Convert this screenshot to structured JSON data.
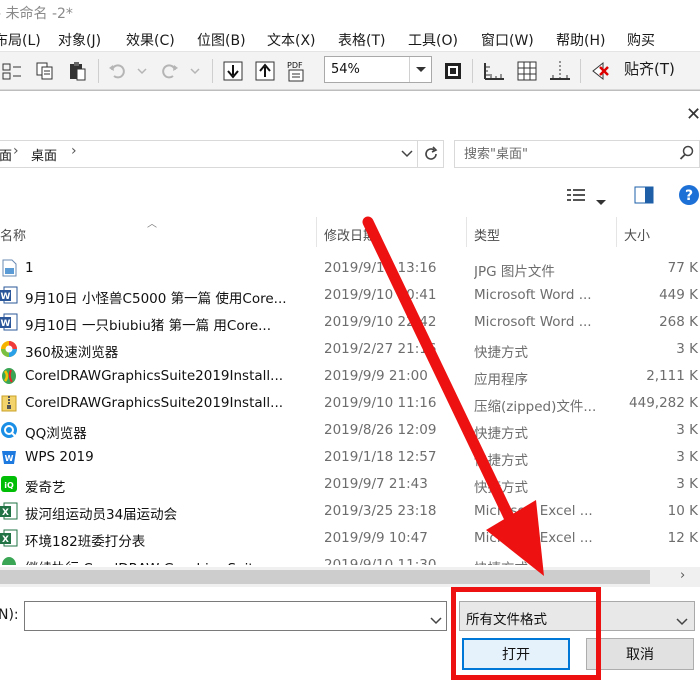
{
  "app": {
    "title": "- 未命名 -2*",
    "menu": [
      "布局(L)",
      "对象(J)",
      "效果(C)",
      "位图(B)",
      "文本(X)",
      "表格(T)",
      "工具(O)",
      "窗口(W)",
      "帮助(H)",
      "购买"
    ],
    "toolbar": {
      "zoom_value": "54%",
      "snap_label": "贴齐(T)"
    }
  },
  "dialog": {
    "close_glyph": "✕",
    "breadcrumb": [
      "面",
      "桌面"
    ],
    "search_placeholder": "搜索\"桌面\"",
    "columns": {
      "name": "名称",
      "date": "修改日期",
      "type": "类型",
      "size": "大小"
    },
    "files": [
      {
        "name": "1",
        "date": "2019/9/11 13:16",
        "type": "JPG 图片文件",
        "size": "77 K",
        "icon": "image-file-icon"
      },
      {
        "name": "9月10日 小怪兽C5000 第一篇 使用Core...",
        "date": "2019/9/10 20:41",
        "type": "Microsoft Word ...",
        "size": "449 K",
        "icon": "word-doc-icon"
      },
      {
        "name": "9月10日 一只biubiu猪 第一篇 用Core...",
        "date": "2019/9/10 22:42",
        "type": "Microsoft Word ...",
        "size": "268 K",
        "icon": "word-doc-icon"
      },
      {
        "name": "360极速浏览器",
        "date": "2019/2/27 21:16",
        "type": "快捷方式",
        "size": "3 K",
        "icon": "browser-360-icon"
      },
      {
        "name": "CorelDRAWGraphicsSuite2019Install...",
        "date": "2019/9/9 21:00",
        "type": "应用程序",
        "size": "2,111 K",
        "icon": "installer-icon"
      },
      {
        "name": "CorelDRAWGraphicsSuite2019Install...",
        "date": "2019/9/10 11:16",
        "type": "压缩(zipped)文件...",
        "size": "449,282 K",
        "icon": "zip-folder-icon"
      },
      {
        "name": "QQ浏览器",
        "date": "2019/8/26 12:09",
        "type": "快捷方式",
        "size": "3 K",
        "icon": "qq-browser-icon"
      },
      {
        "name": "WPS 2019",
        "date": "2019/1/18 12:57",
        "type": "快捷方式",
        "size": "3 K",
        "icon": "wps-icon"
      },
      {
        "name": "爱奇艺",
        "date": "2019/9/7 21:43",
        "type": "快捷方式",
        "size": "3 K",
        "icon": "iqiyi-icon"
      },
      {
        "name": "拔河组运动员34届运动会",
        "date": "2019/3/25 23:18",
        "type": "Microsoft Excel ...",
        "size": "10 K",
        "icon": "excel-icon"
      },
      {
        "name": "环境182班委打分表",
        "date": "2019/9/9 10:47",
        "type": "Microsoft Excel ...",
        "size": "12 K",
        "icon": "excel-icon"
      },
      {
        "name": "继续执行 CorelDRAW Graphics Suit...",
        "date": "2019/9/10 11:30",
        "type": "快捷方式",
        "size": "",
        "icon": "shortcut-icon"
      }
    ],
    "filename_label": "N):",
    "filename_value": "",
    "filetype_value": "所有文件格式",
    "open_label": "打开",
    "cancel_label": "取消"
  },
  "colors": {
    "annotation_red": "#ee1111",
    "focus_blue": "#0078d7"
  }
}
